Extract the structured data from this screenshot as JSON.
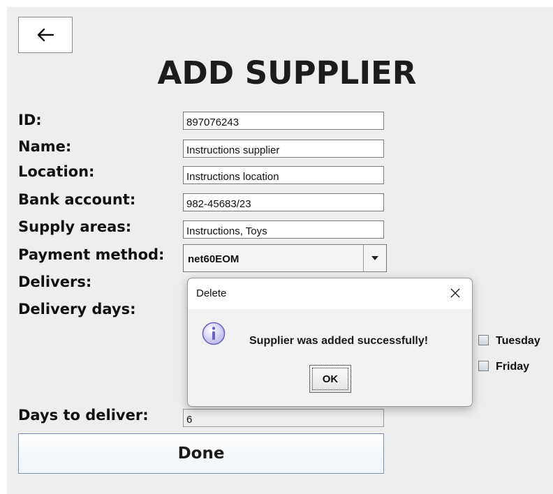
{
  "back_button": {
    "icon": "arrow-left-icon"
  },
  "title": "ADD SUPPLIER",
  "form": {
    "id": {
      "label": "ID:",
      "value": "897076243"
    },
    "name": {
      "label": "Name:",
      "value": "Instructions supplier"
    },
    "location": {
      "label": "Location:",
      "value": "Instructions location"
    },
    "bank_account": {
      "label": "Bank account:",
      "value": "982-45683/23"
    },
    "supply_areas": {
      "label": "Supply areas:",
      "value": "Instructions, Toys"
    },
    "payment_method": {
      "label": "Payment method:",
      "value": "net60EOM"
    },
    "delivers": {
      "label": "Delivers:"
    },
    "delivery_days": {
      "label": "Delivery days:",
      "options": [
        {
          "label": "Tuesday",
          "checked": false
        },
        {
          "label": "Friday",
          "checked": false
        }
      ]
    },
    "days_to_deliver": {
      "label": "Days to deliver:",
      "value": "6"
    }
  },
  "done_button": {
    "label": "Done"
  },
  "dialog": {
    "title": "Delete",
    "message": "Supplier was added successfully!",
    "ok_label": "OK",
    "icon": "info-icon"
  }
}
